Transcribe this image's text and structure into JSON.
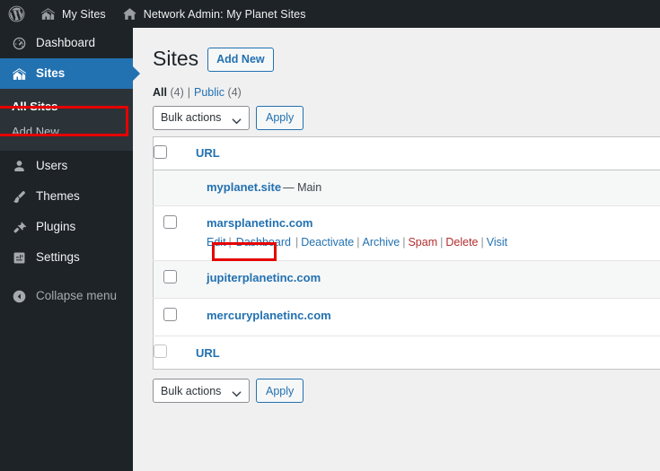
{
  "adminbar": {
    "logo_icon": "wordpress-logo-icon",
    "items": [
      {
        "label": "My Sites",
        "icon": "network-sites-icon"
      },
      {
        "label": "Network Admin: My Planet Sites",
        "icon": "home-icon"
      }
    ]
  },
  "sidebar": {
    "items": [
      {
        "label": "Dashboard",
        "icon": "dashboard-gauge-icon",
        "current": false
      },
      {
        "label": "Sites",
        "icon": "network-sites-icon",
        "current": true
      },
      {
        "label": "Users",
        "icon": "user-icon",
        "current": false
      },
      {
        "label": "Themes",
        "icon": "paintbrush-icon",
        "current": false
      },
      {
        "label": "Plugins",
        "icon": "plug-icon",
        "current": false
      },
      {
        "label": "Settings",
        "icon": "settings-sliders-icon",
        "current": false
      }
    ],
    "submenu": [
      {
        "label": "All Sites",
        "current": true
      },
      {
        "label": "Add New",
        "current": false
      }
    ],
    "collapse": {
      "label": "Collapse menu",
      "icon": "collapse-arrow-icon"
    }
  },
  "page": {
    "title": "Sites",
    "add_new_label": "Add New",
    "filters": [
      {
        "label": "All",
        "count": "(4)",
        "current": true
      },
      {
        "label": "Public",
        "count": "(4)",
        "current": false
      }
    ],
    "filter_separator": "|"
  },
  "tablenav": {
    "bulk_actions_label": "Bulk actions",
    "apply_label": "Apply",
    "chevron_icon": "chevron-down-icon"
  },
  "table": {
    "column_header": "URL",
    "rows": [
      {
        "url": "myplanet.site",
        "suffix": "— Main",
        "has_checkbox": false,
        "alt": true,
        "actions": []
      },
      {
        "url": "marsplanetinc.com",
        "suffix": "",
        "has_checkbox": true,
        "alt": false,
        "actions": [
          {
            "label": "Edit",
            "danger": false
          },
          {
            "label": "Dashboard",
            "danger": false,
            "highlighted": true
          },
          {
            "label": "Deactivate",
            "danger": false
          },
          {
            "label": "Archive",
            "danger": false
          },
          {
            "label": "Spam",
            "danger": true
          },
          {
            "label": "Delete",
            "danger": true
          },
          {
            "label": "Visit",
            "danger": false
          }
        ]
      },
      {
        "url": "jupiterplanetinc.com",
        "suffix": "",
        "has_checkbox": true,
        "alt": true,
        "actions": []
      },
      {
        "url": "mercuryplanetinc.com",
        "suffix": "",
        "has_checkbox": true,
        "alt": false,
        "actions": []
      }
    ],
    "action_separator": "|"
  },
  "colors": {
    "admin_bar": "#1d2327",
    "menu_background": "#1d2327",
    "submenu_background": "#2c3338",
    "current_menu": "#2271b1",
    "link": "#2271b1",
    "danger": "#b32d2e",
    "annotation": "#e60000",
    "content_background": "#f0f0f1"
  }
}
